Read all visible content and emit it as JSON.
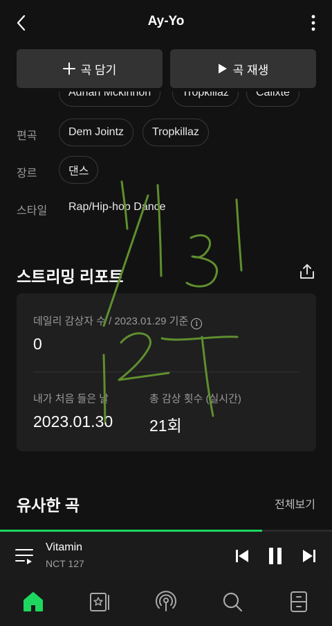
{
  "header": {
    "title": "Ay-Yo"
  },
  "actions": {
    "add_label": "곡 담기",
    "play_label": "곡 재생"
  },
  "credits": {
    "writers_partial": [
      "Adrian Mckinnon",
      "Tropkillaz",
      "Calixte"
    ],
    "arrangement_label": "편곡",
    "arrangers": [
      "Dem Jointz",
      "Tropkillaz"
    ],
    "genre_label": "장르",
    "genre": "댄스",
    "style_label": "스타일",
    "style": "Rap/Hip-hop Dance"
  },
  "report": {
    "title": "스트리밍 리포트",
    "daily_listeners_label": "데일리 감상자 수 / 2023.01.29 기준",
    "daily_listeners_value": "0",
    "first_listen_label": "내가 처음 들은 날",
    "first_listen_value": "2023.01.30",
    "total_plays_label": "총 감상 횟수 (실시간)",
    "total_plays_value": "21회"
  },
  "similar": {
    "title": "유사한 곡",
    "see_all": "전체보기"
  },
  "player": {
    "title": "Vitamin",
    "artist": "NCT 127",
    "progress": 0.79
  },
  "handwriting": {
    "line1": "1/31",
    "line2": "127"
  },
  "colors": {
    "accent": "#1ed760",
    "background": "#121212",
    "button": "#333333",
    "card": "#1f1f1f",
    "scribble": "#5f8f2e"
  },
  "icons": [
    "back-icon",
    "more-icon",
    "plus-icon",
    "play-icon",
    "share-icon",
    "info-icon",
    "playlist-icon",
    "previous-icon",
    "pause-icon",
    "next-icon",
    "home-icon",
    "library-icon",
    "podcast-icon",
    "search-icon",
    "profile-icon"
  ]
}
